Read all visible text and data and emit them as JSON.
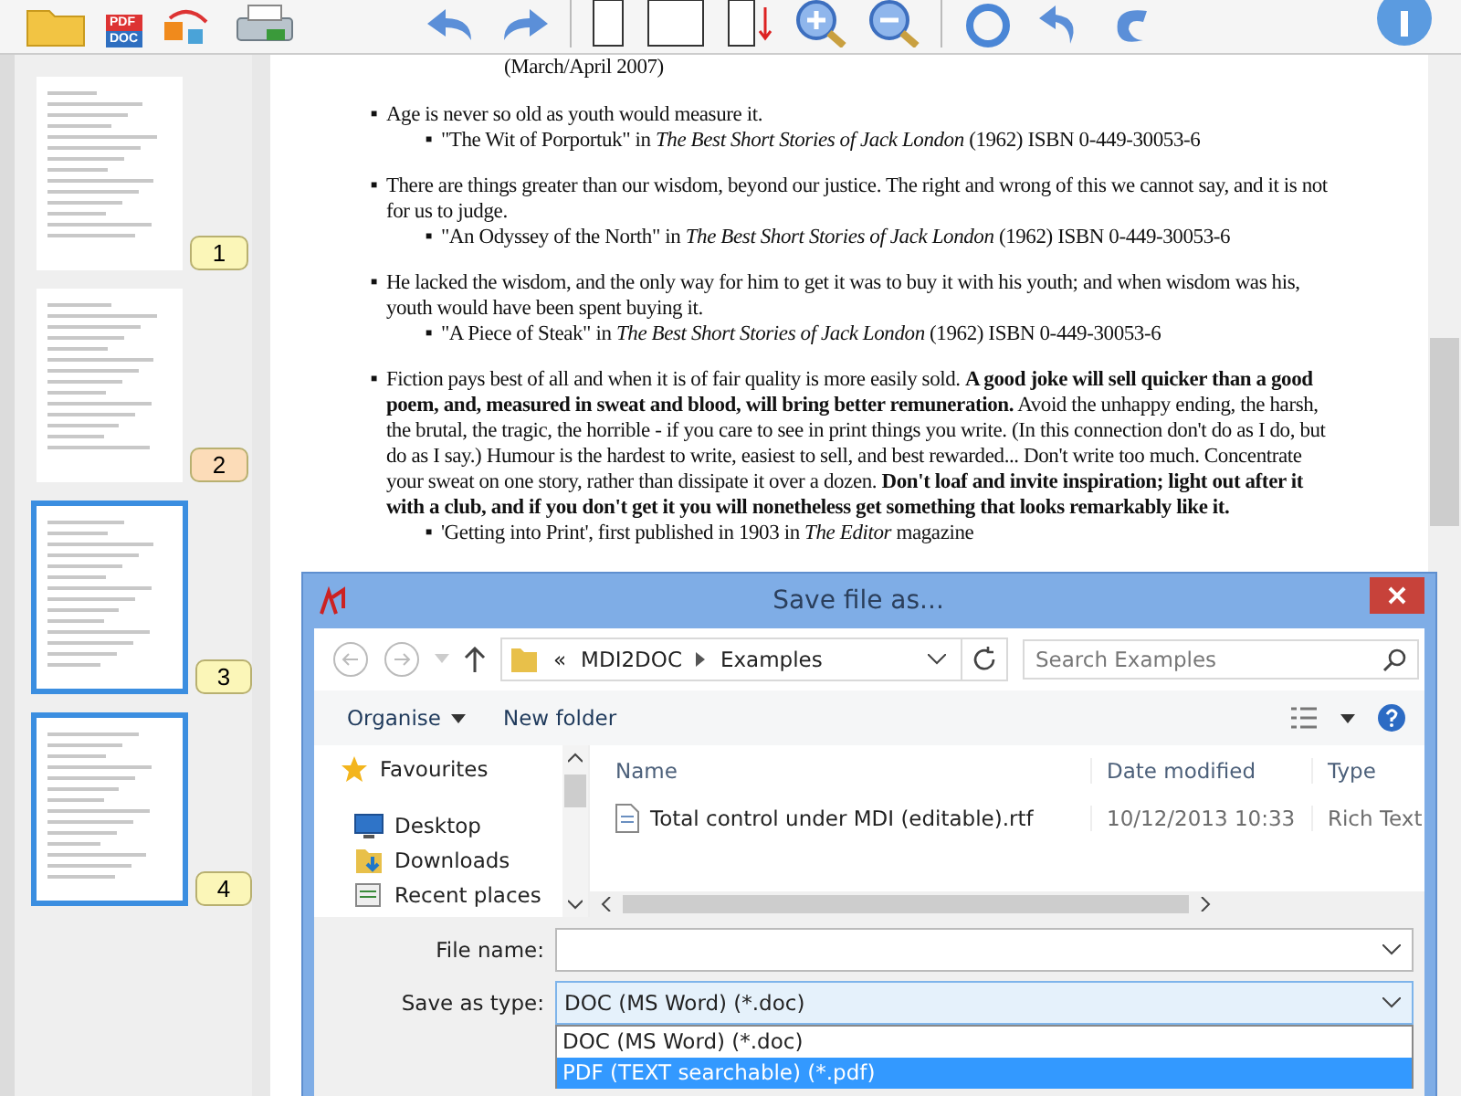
{
  "toolbar": {
    "pdf_icon_labels": [
      "PDF",
      "DOC"
    ]
  },
  "thumbnails": [
    {
      "number": "1",
      "selected": false,
      "color": "#fbf6b8"
    },
    {
      "number": "2",
      "selected": false,
      "color": "#fcdcb8"
    },
    {
      "number": "3",
      "selected": true,
      "color": "#fbf6b8"
    },
    {
      "number": "4",
      "selected": true,
      "color": "#fbf6b8"
    }
  ],
  "document": {
    "top_line": "(March/April 2007)",
    "marker": "■",
    "quotes": [
      {
        "text": "Age is never so old as youth would measure it.",
        "source": "\"The Wit of Porportuk\" in *The Best Short Stories of Jack London* (1962) ISBN 0-449-30053-6"
      },
      {
        "text": "There are things greater than our wisdom, beyond our justice. The right and wrong of this we cannot say, and it is not for us to judge.",
        "source": "\"An Odyssey of the North\" in *The Best Short Stories of Jack London* (1962) ISBN 0-449-30053-6"
      },
      {
        "text": "He lacked the wisdom, and the only way for him to get it was to buy it with his youth; and when wisdom was his, youth would have been spent buying it.",
        "source": "\"A Piece of Steak\" in *The Best Short Stories of Jack London* (1962) ISBN 0-449-30053-6"
      },
      {
        "text": "Fiction pays best of all and when it is of fair quality is more easily sold. **A good joke will sell quicker than a good poem, and, measured in sweat and blood, will bring better remuneration.** Avoid the unhappy ending, the harsh, the brutal, the tragic, the horrible - if you care to see in print things you write. (In this connection don't do as I do, but do as I say.) Humour is the hardest to write, easiest to sell, and best rewarded... Don't write too much. Concentrate your sweat on one story, rather than dissipate it over a dozen. **Don't loaf and invite inspiration; light out after it with a club, and if you don't get it you will nonetheless get something that looks remarkably like it.**",
        "source": "'Getting into Print', first published in 1903 in *The Editor* magazine"
      }
    ]
  },
  "dialog": {
    "title": "Save file as...",
    "breadcrumb": [
      "«",
      "MDI2DOC",
      "Examples"
    ],
    "search": {
      "placeholder": "Search Examples"
    },
    "commands": [
      "Organise",
      "New folder"
    ],
    "nav": [
      {
        "label": "Favourites",
        "kind": "star"
      },
      {
        "label": "Desktop",
        "kind": "desktop"
      },
      {
        "label": "Downloads",
        "kind": "downloads"
      },
      {
        "label": "Recent places",
        "kind": "recent"
      }
    ],
    "columns": [
      "Name",
      "Date modified",
      "Type"
    ],
    "files": [
      {
        "name": "Total control under MDI (editable).rtf",
        "date": "10/12/2013 10:33",
        "type": "Rich Text"
      }
    ],
    "file_name_label": "File name:",
    "save_type_label": "Save as type:",
    "save_type_value": "DOC (MS Word)   (*.doc)",
    "type_options": [
      {
        "label": "DOC (MS Word)   (*.doc)",
        "selected": false
      },
      {
        "label": "PDF (TEXT searchable)   (*.pdf)",
        "selected": true
      }
    ]
  }
}
